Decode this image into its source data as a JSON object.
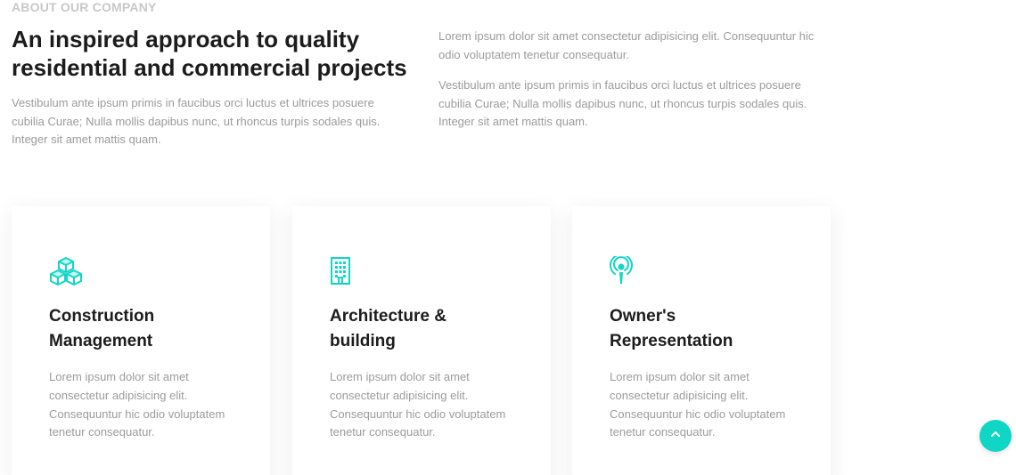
{
  "about": {
    "eyebrow": "ABOUT OUR COMPANY",
    "headline": "An inspired approach to quality residential and commercial projects",
    "intro_left": "Vestibulum ante ipsum primis in faucibus orci luctus et ultrices posuere cubilia Curae; Nulla mollis dapibus nunc, ut rhoncus turpis sodales quis. Integer sit amet mattis quam.",
    "right_paragraphs": [
      "Lorem ipsum dolor sit amet consectetur adipisicing elit. Consequuntur hic odio voluptatem tenetur consequatur.",
      "Vestibulum ante ipsum primis in faucibus orci luctus et ultrices posuere cubilia Curae; Nulla mollis dapibus nunc, ut rhoncus turpis sodales quis. Integer sit amet mattis quam."
    ]
  },
  "services": [
    {
      "icon": "cubes-icon",
      "title": "Construction Management",
      "text": "Lorem ipsum dolor sit amet consectetur adipisicing elit. Consequuntur hic odio voluptatem tenetur consequatur."
    },
    {
      "icon": "building-icon",
      "title": "Architecture & building",
      "text": "Lorem ipsum dolor sit amet consectetur adipisicing elit. Consequuntur hic odio voluptatem tenetur consequatur."
    },
    {
      "icon": "podcast-icon",
      "title": "Owner's Representation",
      "text": "Lorem ipsum dolor sit amet consectetur adipisicing elit. Consequuntur hic odio voluptatem tenetur consequatur."
    }
  ],
  "scroll_top": {
    "icon": "chevron-up-icon"
  },
  "colors": {
    "accent": "#10d6c6",
    "heading": "#1c1c1c",
    "body_text": "#9b9b9b",
    "eyebrow": "#c8c8c8"
  }
}
